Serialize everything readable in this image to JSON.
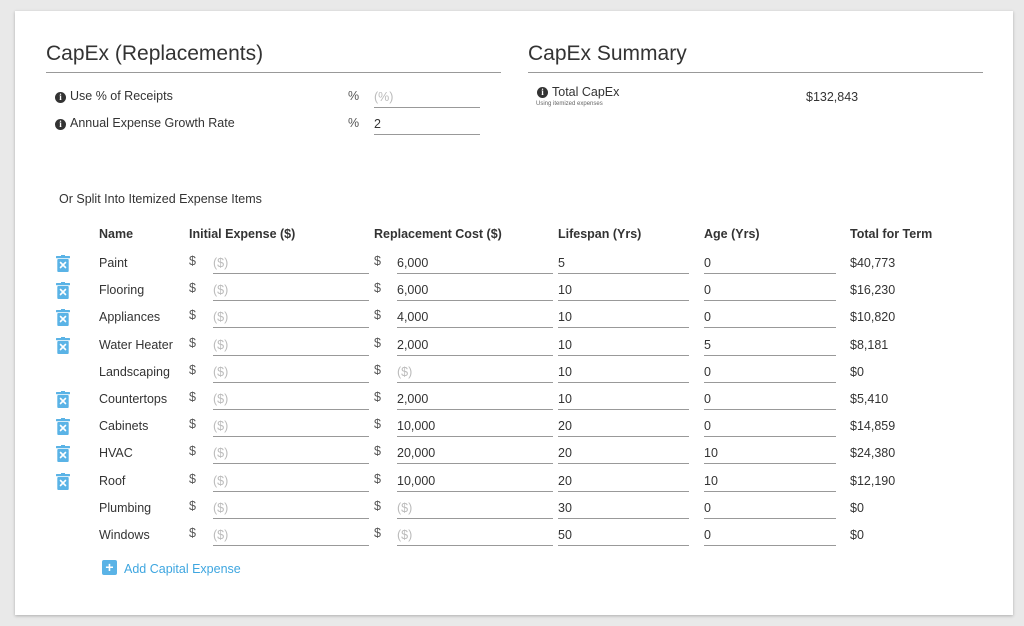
{
  "left_title": "CapEx (Replacements)",
  "right_title": "CapEx Summary",
  "settings": {
    "receipts_label": "Use % of Receipts",
    "receipts_unit": "%",
    "receipts_placeholder": "(%)",
    "growth_label": "Annual Expense Growth Rate",
    "growth_unit": "%",
    "growth_value": "2"
  },
  "summary": {
    "total_label": "Total CapEx",
    "total_sub": "Using itemized expenses",
    "total_value": "$132,843"
  },
  "split_label": "Or Split Into Itemized Expense Items",
  "columns": [
    "Name",
    "Initial Expense ($)",
    "Replacement Cost ($)",
    "Lifespan (Yrs)",
    "Age (Yrs)",
    "Total for Term"
  ],
  "currency_symbol": "$",
  "money_placeholder": "($)",
  "rows": [
    {
      "name": "Paint",
      "deletable": true,
      "initial": "",
      "replacement": "6,000",
      "lifespan": "5",
      "age": "0",
      "total": "$40,773"
    },
    {
      "name": "Flooring",
      "deletable": true,
      "initial": "",
      "replacement": "6,000",
      "lifespan": "10",
      "age": "0",
      "total": "$16,230"
    },
    {
      "name": "Appliances",
      "deletable": true,
      "initial": "",
      "replacement": "4,000",
      "lifespan": "10",
      "age": "0",
      "total": "$10,820"
    },
    {
      "name": "Water Heater",
      "deletable": true,
      "initial": "",
      "replacement": "2,000",
      "lifespan": "10",
      "age": "5",
      "total": "$8,181"
    },
    {
      "name": "Landscaping",
      "deletable": false,
      "initial": "",
      "replacement": "",
      "lifespan": "10",
      "age": "0",
      "total": "$0"
    },
    {
      "name": "Countertops",
      "deletable": true,
      "initial": "",
      "replacement": "2,000",
      "lifespan": "10",
      "age": "0",
      "total": "$5,410"
    },
    {
      "name": "Cabinets",
      "deletable": true,
      "initial": "",
      "replacement": "10,000",
      "lifespan": "20",
      "age": "0",
      "total": "$14,859"
    },
    {
      "name": "HVAC",
      "deletable": true,
      "initial": "",
      "replacement": "20,000",
      "lifespan": "20",
      "age": "10",
      "total": "$24,380"
    },
    {
      "name": "Roof",
      "deletable": true,
      "initial": "",
      "replacement": "10,000",
      "lifespan": "20",
      "age": "10",
      "total": "$12,190"
    },
    {
      "name": "Plumbing",
      "deletable": false,
      "initial": "",
      "replacement": "",
      "lifespan": "30",
      "age": "0",
      "total": "$0"
    },
    {
      "name": "Windows",
      "deletable": false,
      "initial": "",
      "replacement": "",
      "lifespan": "50",
      "age": "0",
      "total": "$0"
    }
  ],
  "add_label": "Add Capital Expense",
  "colors": {
    "accent": "#5ab3e6",
    "link": "#3ea6e0",
    "text": "#333333"
  }
}
